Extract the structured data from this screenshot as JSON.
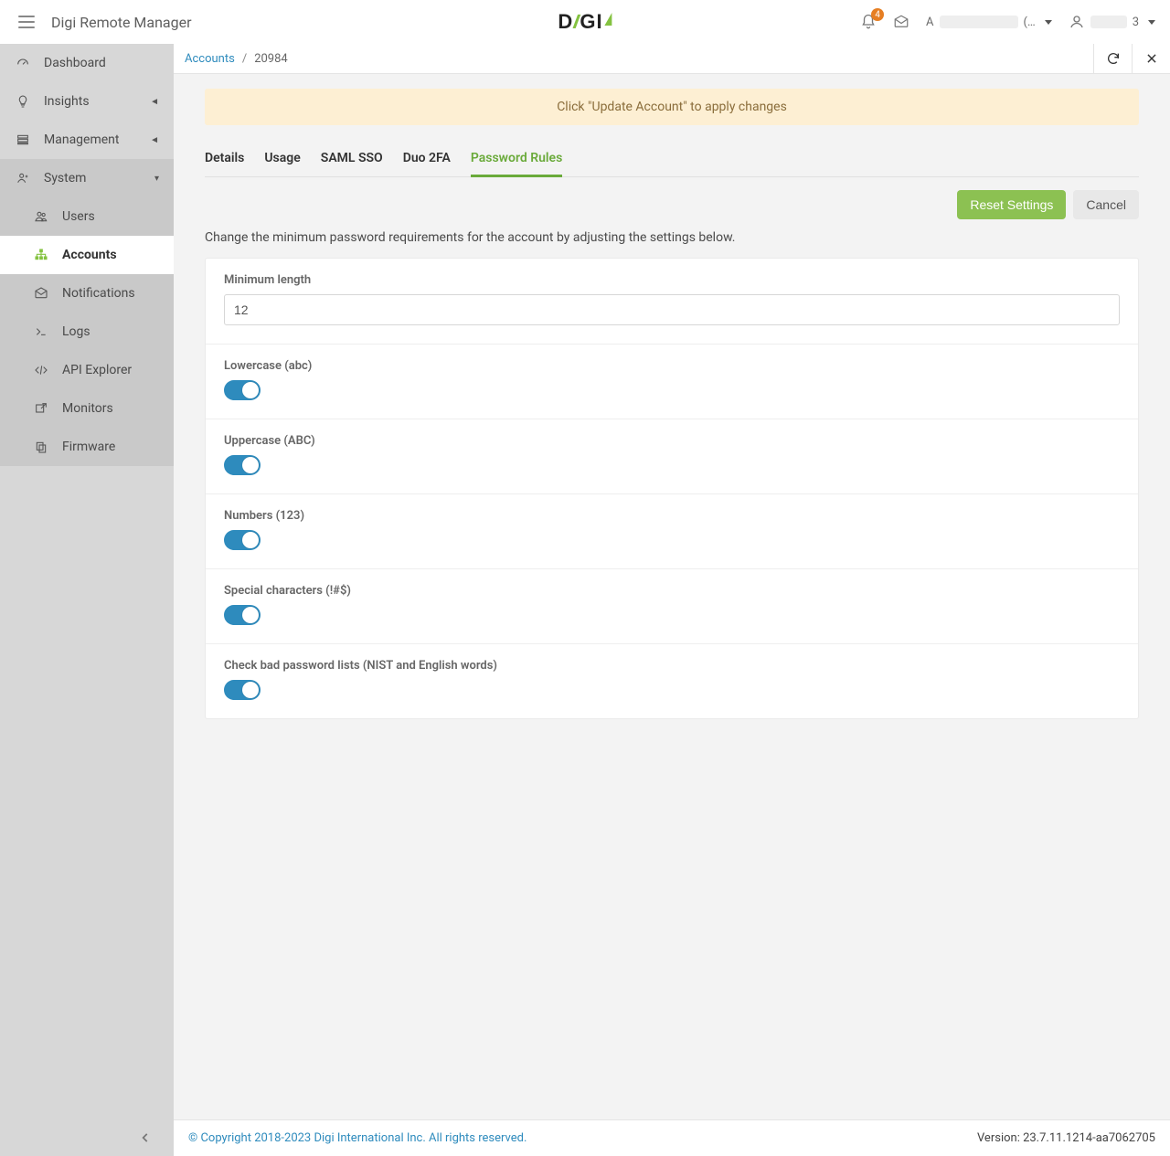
{
  "app_title": "Digi Remote Manager",
  "logo_text": "DIGI",
  "topbar": {
    "notifications_count": "4",
    "account_prefix": "A",
    "account_suffix": "(…",
    "user_suffix": "3"
  },
  "sidebar": {
    "items": {
      "dashboard": "Dashboard",
      "insights": "Insights",
      "management": "Management",
      "system": "System"
    },
    "system_children": {
      "users": "Users",
      "accounts": "Accounts",
      "notifications": "Notifications",
      "logs": "Logs",
      "api_explorer": "API Explorer",
      "monitors": "Monitors",
      "firmware": "Firmware"
    }
  },
  "breadcrumb": {
    "root": "Accounts",
    "sep": "/",
    "current": "20984"
  },
  "banner": "Click \"Update Account\" to apply changes",
  "tabs": {
    "details": "Details",
    "usage": "Usage",
    "saml": "SAML SSO",
    "duo": "Duo 2FA",
    "password_rules": "Password Rules"
  },
  "actions": {
    "reset": "Reset Settings",
    "cancel": "Cancel"
  },
  "intro": "Change the minimum password requirements for the account by adjusting the settings below.",
  "form": {
    "min_length_label": "Minimum length",
    "min_length_value": "12",
    "lowercase_label": "Lowercase (abc)",
    "lowercase_on": true,
    "uppercase_label": "Uppercase (ABC)",
    "uppercase_on": true,
    "numbers_label": "Numbers (123)",
    "numbers_on": true,
    "special_label": "Special characters (!#$)",
    "special_on": true,
    "badlist_label": "Check bad password lists (NIST and English words)",
    "badlist_on": true
  },
  "footer": {
    "copyright": "© Copyright 2018-2023 Digi International Inc. All rights reserved.",
    "version": "Version: 23.7.11.1214-aa7062705"
  }
}
